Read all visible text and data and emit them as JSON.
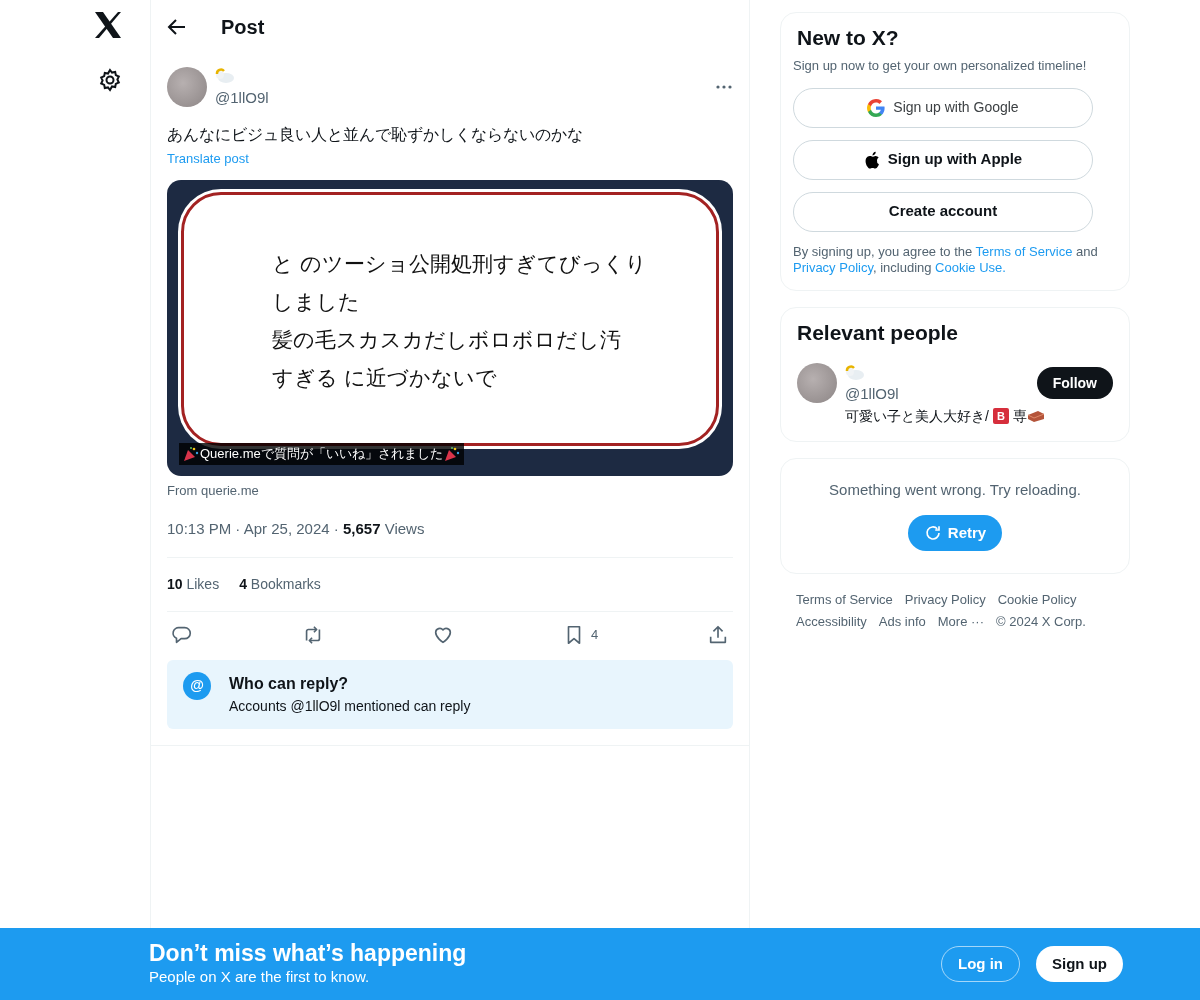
{
  "header": {
    "title": "Post"
  },
  "post": {
    "handle": "@1llO9l",
    "text": "あんなにビジュ良い人と並んで恥ずかしくならないのかな",
    "translate": "Translate post",
    "image": {
      "lines": [
        "と のツーショ公開処刑すぎてびっくり",
        "しました",
        "髪の毛スカスカだしボロボロだし汚",
        "すぎる に近づかないで"
      ],
      "caption": "Querie.meで質問が「いいね」されました"
    },
    "source": "From querie.me",
    "meta": "10:13 PM · Apr 25, 2024 · **5,657** Views",
    "stats": [
      "**10** Likes",
      "**4** Bookmarks"
    ],
    "actions": [
      {
        "kind": "reply"
      },
      {
        "kind": "repost"
      },
      {
        "kind": "like"
      },
      {
        "kind": "bookmark",
        "count": "4"
      },
      {
        "kind": "share"
      }
    ],
    "reply_notice": {
      "symbol": "@",
      "title": "Who can reply?",
      "text": "Accounts @1llO9l mentioned can reply"
    }
  },
  "signup": {
    "title": "New to X?",
    "subtitle": "Sign up now to get your own personalized timeline!",
    "buttons": [
      {
        "kind": "google",
        "label": "Sign up with Google"
      },
      {
        "kind": "apple",
        "label": "Sign up with Apple"
      },
      {
        "kind": "create",
        "label": "Create account"
      }
    ],
    "legal": [
      {
        "kind": "text",
        "text": "By signing up, you agree to the "
      },
      {
        "kind": "link",
        "text": "Terms of Service"
      },
      {
        "kind": "text",
        "text": " and "
      },
      {
        "kind": "link",
        "text": "Privacy Policy"
      },
      {
        "kind": "text",
        "text": ", including "
      },
      {
        "kind": "link",
        "text": "Cookie Use."
      }
    ]
  },
  "relevant": {
    "title": "Relevant people",
    "people": [
      {
        "handle": "@1llO9l",
        "button": "Follow",
        "bio": [
          {
            "kind": "text",
            "text": "可愛い子と美人大好き/"
          },
          {
            "kind": "badge",
            "text": "B"
          },
          {
            "kind": "text",
            "text": "専"
          },
          {
            "kind": "brick"
          }
        ]
      }
    ]
  },
  "error": {
    "message": "Something went wrong. Try reloading.",
    "button": "Retry"
  },
  "footer": [
    "Terms of Service",
    "Privacy Policy",
    "Cookie Policy",
    "Accessibility",
    "Ads info",
    "More ···",
    "© 2024 X Corp."
  ],
  "banner": {
    "title": "Don’t miss what’s happening",
    "subtitle": "People on X are the first to know.",
    "buttons": [
      {
        "kind": "login",
        "label": "Log in"
      },
      {
        "kind": "signup",
        "label": "Sign up"
      }
    ]
  }
}
